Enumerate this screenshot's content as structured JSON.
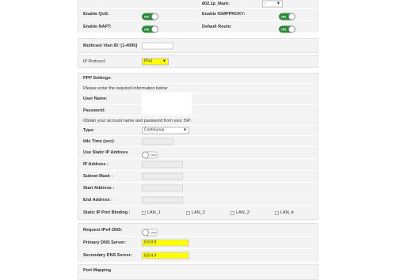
{
  "qos": {
    "mark_label": "802.1p_Mark:",
    "mark_value": "-",
    "enable_qos": "Enable QoS:",
    "enable_qos_state": "ON",
    "enable_igmp": "Enable IGMPPROXY:",
    "enable_igmp_state": "ON",
    "enable_napt": "Enable NAPT:",
    "enable_napt_state": "ON",
    "default_route": "Default Route:",
    "default_route_state": "ON"
  },
  "multicast": {
    "label": "Multicast Vlan ID: [1-4095]",
    "value": ""
  },
  "protocol": {
    "label": "IP Protocol:",
    "value": "IPv4"
  },
  "ppp": {
    "title": "PPP Settings:",
    "hint": "Please enter the required information below",
    "user_label": "User Name:",
    "password_label": "Password:",
    "obtain_hint": "Obtain your account name and password from your ISP.",
    "type_label": "Type:",
    "type_value": "Continuous",
    "idle_label": "Idle Time (sec):",
    "static_ip_label": "Use Static IP Address",
    "static_ip_state": "OFF",
    "ip_label": "IP Address :",
    "subnet_label": "Subnet Mask :",
    "start_label": "Start Address :",
    "end_label": "End Address :",
    "binding_label": "Static IP Port Binding :",
    "ports": [
      "LAN_1",
      "LAN_2",
      "LAN_3",
      "LAN_4"
    ]
  },
  "dns": {
    "request_label": "Request IPv4 DNS:",
    "request_state": "OFF",
    "primary_label": "Primary DNS Server:",
    "primary_value": "8.8.8.8",
    "secondary_label": "Secondary DNS Server:",
    "secondary_value": "8.8.4.4"
  },
  "port_mapping": {
    "title": "Port Mapping"
  }
}
